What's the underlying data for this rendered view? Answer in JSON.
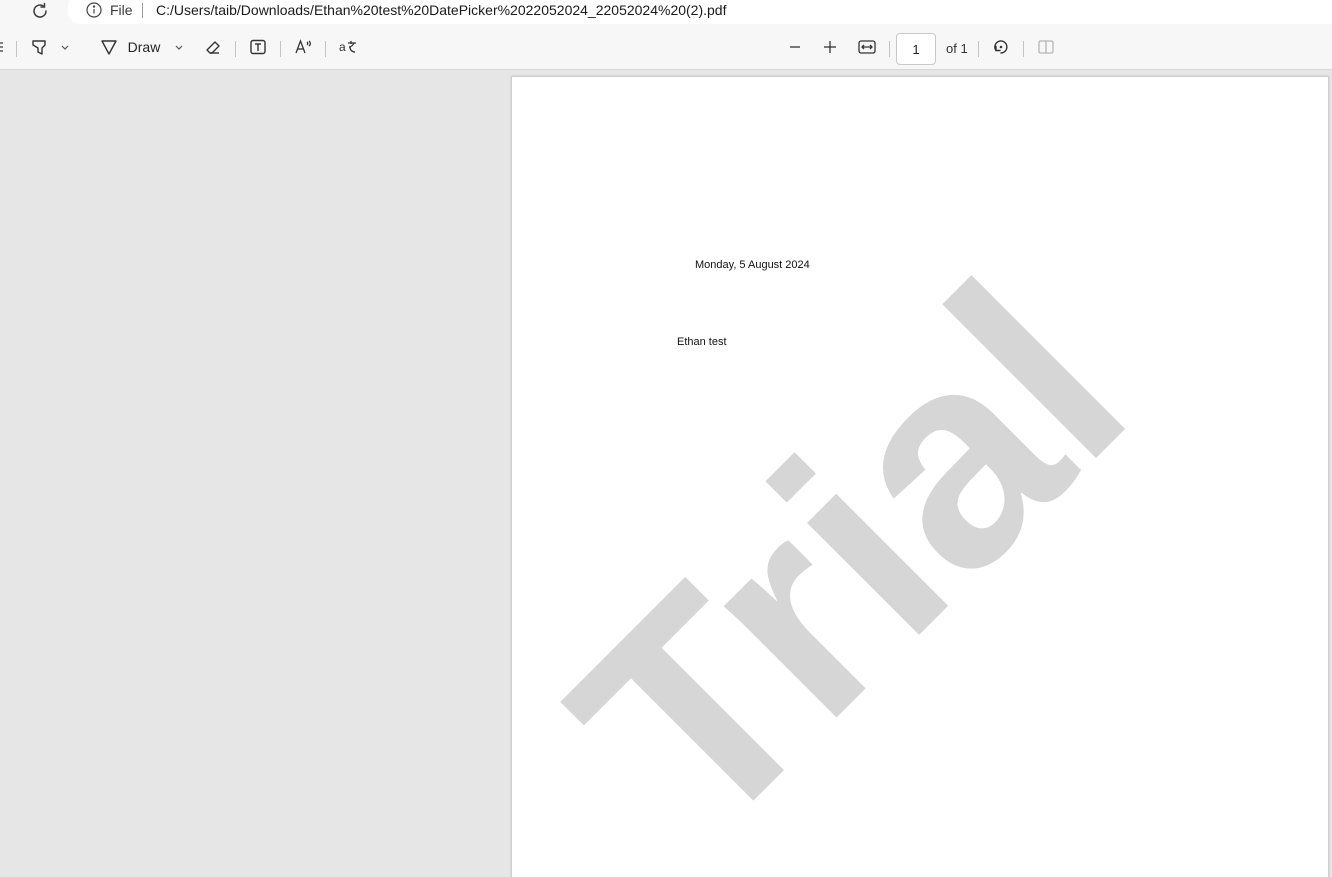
{
  "address_bar": {
    "scheme_label": "File",
    "url": "C:/Users/taib/Downloads/Ethan%20test%20DatePicker%2022052024_22052024%20(2).pdf"
  },
  "toolbar": {
    "draw_label": "Draw",
    "page_number": "1",
    "page_of": "of 1",
    "icons": [
      "highlight-icon",
      "draw-icon",
      "eraser-icon",
      "text-box-icon",
      "read-aloud-icon",
      "translate-icon",
      "zoom-out-icon",
      "zoom-in-icon",
      "fit-width-icon",
      "rotate-icon",
      "page-view-icon"
    ]
  },
  "document": {
    "date_text": "Monday, 5 August 2024",
    "name_text": "Ethan test",
    "watermark_text": "Trial",
    "watermark_color": "#d6d6d6"
  }
}
